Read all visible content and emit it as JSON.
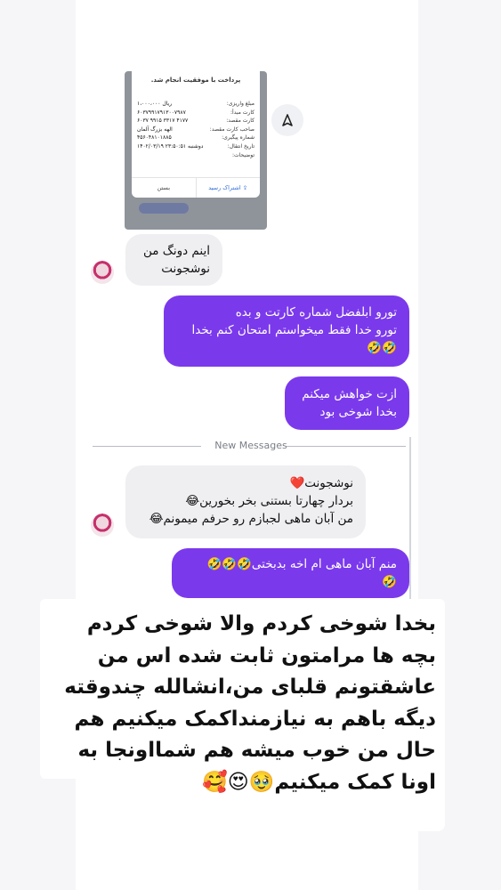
{
  "receipt": {
    "title": "پرداخت با موفقیت انجام شد.",
    "rows": [
      {
        "label": "مبلغ واریزی:",
        "value": "۱،۰۰۰،۰۰۰ ریال"
      },
      {
        "label": "کارت مبدأ:",
        "value": "۶۰۳۷۹۹۱۷۹۱۳۰۰۷۹۸۷"
      },
      {
        "label": "کارت مقصد:",
        "value": "۶۰۳۷ ۹۹۱۵ ۳۳۱۷ ۴۱۷۷"
      },
      {
        "label": "صاحب کارت مقصد:",
        "value": "الهه بزرگ آلمان"
      },
      {
        "label": "شماره پیگیری:",
        "value": "۴۵۶۰۴۸۱۰۱۸۸۵"
      },
      {
        "label": "تاریخ انتقال:",
        "value": "۱۴۰۲/۰۳/۱۹ دوشنبه ۲۳:۵۰:۵۱"
      },
      {
        "label": "توضیحات:",
        "value": ""
      }
    ],
    "share_label": "اشتراک رسید",
    "close_label": "بستن"
  },
  "messages": {
    "m1": {
      "lines": [
        "اینم دونگ من",
        "نوشجونت"
      ]
    },
    "m2": {
      "lines": [
        "تورو ابلفضل شماره کارتت و بده",
        "تورو خدا فقط میخواستم امتحان کنم بخدا",
        "🤣🤣"
      ]
    },
    "m3": {
      "lines": [
        "ازت خواهش میکنم",
        "بخدا شوخی بود"
      ]
    },
    "m4": {
      "lines": [
        "نوشجونت❤️",
        "بردار چهارتا بستنی بخر بخورین😂",
        "من آبان ماهی لجبازم رو حرفم میمونم😂"
      ]
    },
    "m5": {
      "lines": [
        "منم آبان ماهی ام اخه بدبختی🤣🤣🤣",
        "🤣"
      ]
    }
  },
  "separator_label": "New Messages",
  "caption": {
    "text": "بخدا شوخی کردم والا شوخی کردم\nبچه ها مرامتون ثابت شده اس من\nعاشقتونم قلبای من،انشالله چندوقته\nدیگه باهم به نیازمنداکمک میکنیم هم\nحال من خوب میشه هم شمااونجا به\nاونا کمک میکنیم🥹😍🥰"
  },
  "icons": {
    "share": "send-icon",
    "avatar": "avatar"
  },
  "colors": {
    "outgoing": "#7b39ec",
    "incoming": "#efeff2"
  }
}
